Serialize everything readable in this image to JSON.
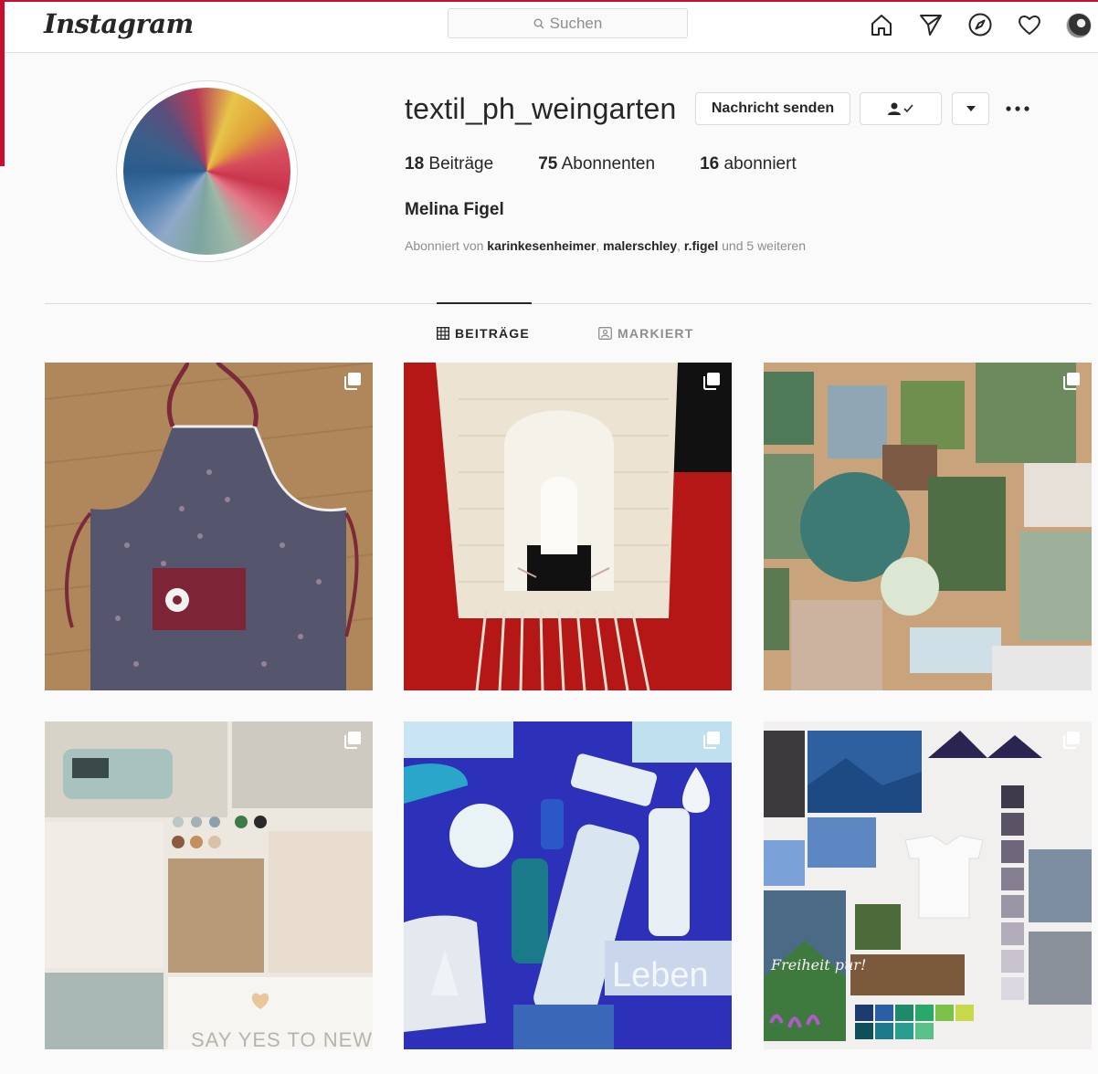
{
  "header": {
    "logo": "Instagram",
    "search_placeholder": "Suchen",
    "icons": [
      "home-icon",
      "direct-icon",
      "explore-icon",
      "heart-icon",
      "profile-avatar"
    ]
  },
  "profile": {
    "username": "textil_ph_weingarten",
    "message_button": "Nachricht senden",
    "posts_count": "18",
    "posts_label": "Beiträge",
    "followers_count": "75",
    "followers_label": "Abonnenten",
    "following_count": "16",
    "following_label": "abonniert",
    "full_name": "Melina Figel",
    "followed_by_prefix": "Abonniert von",
    "followed_by_users": [
      "karinkesenheimer",
      "malerschley",
      "r.figel"
    ],
    "followed_by_suffix": "und 5 weiteren"
  },
  "tabs": {
    "posts": "BEITRÄGE",
    "tagged": "MARKIERT"
  },
  "posts": [
    {
      "desc": "apron",
      "multi": true
    },
    {
      "desc": "weaving",
      "multi": true
    },
    {
      "desc": "nature moodboard",
      "multi": true
    },
    {
      "desc": "beige moodboard",
      "multi": true,
      "caption": "SAY YES TO NEW"
    },
    {
      "desc": "blue moodboard",
      "multi": true,
      "caption": "Leben"
    },
    {
      "desc": "alps moodboard",
      "multi": true,
      "caption": "Freiheit pur!"
    }
  ],
  "colors": {
    "accent_red": "#c8102e",
    "border": "#dbdbdb",
    "text": "#262626",
    "muted": "#8e8e8e"
  }
}
